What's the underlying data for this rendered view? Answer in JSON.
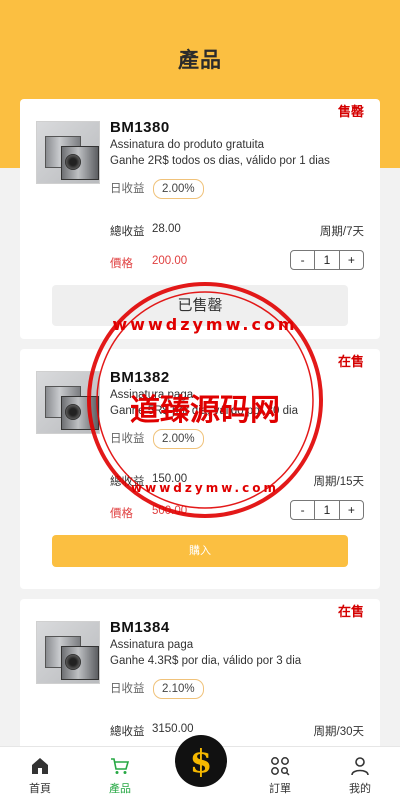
{
  "header": {
    "title": "產品"
  },
  "products": [
    {
      "status": "售罄",
      "name": "BM1380",
      "desc1": "Assinatura do produto gratuita",
      "desc2": "Ganhe 2R$ todos os dias, válido por 1 dias",
      "rate_label": "日收益",
      "rate": "2.00%",
      "total_label": "總收益",
      "total": "28.00",
      "period": "周期/7天",
      "price_label": "價格",
      "price": "200.00",
      "qty_minus": "-",
      "qty": "1",
      "qty_plus": "+",
      "action": "已售罄"
    },
    {
      "status": "在售",
      "name": "BM1382",
      "desc1": "Assinatura paga",
      "desc2": "Ganhe 5R$ por dia, válido por 30 dia",
      "rate_label": "日收益",
      "rate": "2.00%",
      "total_label": "總收益",
      "total": "150.00",
      "period": "周期/15天",
      "price_label": "價格",
      "price": "500.00",
      "qty_minus": "-",
      "qty": "1",
      "qty_plus": "+",
      "action": "購入"
    },
    {
      "status": "在售",
      "name": "BM1384",
      "desc1": "Assinatura paga",
      "desc2": "Ganhe 4.3R$ por dia, válido por 3 dia",
      "rate_label": "日收益",
      "rate": "2.10%",
      "total_label": "總收益",
      "total": "3150.00",
      "period": "周期/30天"
    }
  ],
  "tabbar": {
    "home": "首頁",
    "products": "產品",
    "orders": "訂單",
    "mine": "我的",
    "center_symbol": "$"
  },
  "watermark": {
    "center_text": "道臻源码网",
    "url_letters_top": "wwwdzymw.com",
    "url_letters_bottom": "wwwdzymw.com"
  },
  "colors": {
    "accent": "#fbbf41",
    "status_red": "#d40000",
    "price_red": "#e04040",
    "active_tab": "#27a844",
    "watermark_red": "#e00000"
  }
}
